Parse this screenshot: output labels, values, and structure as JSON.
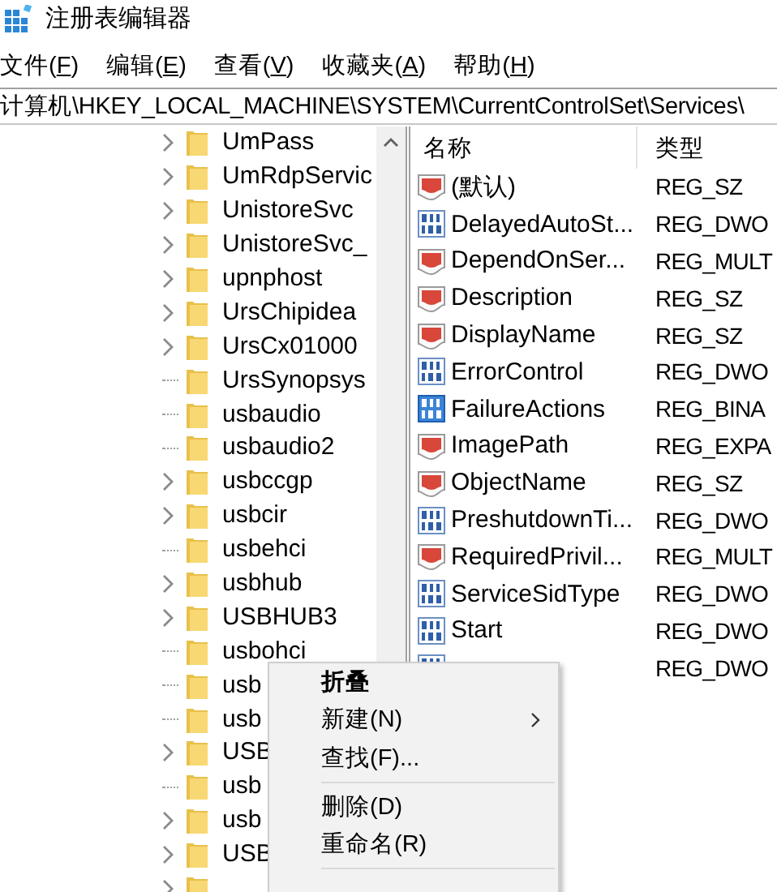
{
  "window": {
    "title": "注册表编辑器"
  },
  "menu_bar": [
    {
      "label": "文件(F)"
    },
    {
      "label": "编辑(E)"
    },
    {
      "label": "查看(V)"
    },
    {
      "label": "收藏夹(A)"
    },
    {
      "label": "帮助(H)"
    }
  ],
  "address_bar": {
    "value": "计算机\\HKEY_LOCAL_MACHINE\\SYSTEM\\CurrentControlSet\\Services\\"
  },
  "tree": {
    "items": [
      {
        "label": "UmPass",
        "expandable": true
      },
      {
        "label": "UmRdpServic",
        "expandable": true
      },
      {
        "label": "UnistoreSvc",
        "expandable": true
      },
      {
        "label": "UnistoreSvc_",
        "expandable": true
      },
      {
        "label": "upnphost",
        "expandable": true
      },
      {
        "label": "UrsChipidea",
        "expandable": true
      },
      {
        "label": "UrsCx01000",
        "expandable": true
      },
      {
        "label": "UrsSynopsys",
        "expandable": false
      },
      {
        "label": "usbaudio",
        "expandable": false
      },
      {
        "label": "usbaudio2",
        "expandable": false
      },
      {
        "label": "usbccgp",
        "expandable": true
      },
      {
        "label": "usbcir",
        "expandable": true
      },
      {
        "label": "usbehci",
        "expandable": false
      },
      {
        "label": "usbhub",
        "expandable": true
      },
      {
        "label": "USBHUB3",
        "expandable": true
      },
      {
        "label": "usbohci",
        "expandable": false
      },
      {
        "label": "usb",
        "expandable": false
      },
      {
        "label": "usb",
        "expandable": false
      },
      {
        "label": "USB",
        "expandable": true
      },
      {
        "label": "usb",
        "expandable": false
      },
      {
        "label": "usb",
        "expandable": true
      },
      {
        "label": "USB",
        "expandable": true
      },
      {
        "expandable": true
      }
    ]
  },
  "values": {
    "columns": [
      "名称",
      "类型"
    ],
    "rows": [
      {
        "kind": "string",
        "name": "(默认)",
        "type": "REG_SZ"
      },
      {
        "kind": "number",
        "name": "DelayedAutoSt...",
        "type": "REG_DWO"
      },
      {
        "kind": "string",
        "name": "DependOnSer...",
        "type": "REG_MULT"
      },
      {
        "kind": "string",
        "name": "Description",
        "type": "REG_SZ"
      },
      {
        "kind": "string",
        "name": "DisplayName",
        "type": "REG_SZ"
      },
      {
        "kind": "number",
        "name": "ErrorControl",
        "type": "REG_DWO"
      },
      {
        "kind": "binary",
        "name": "FailureActions",
        "type": "REG_BINA"
      },
      {
        "kind": "string",
        "name": "ImagePath",
        "type": "REG_EXPA"
      },
      {
        "kind": "string",
        "name": "ObjectName",
        "type": "REG_SZ"
      },
      {
        "kind": "number",
        "name": "PreshutdownTi...",
        "type": "REG_DWO"
      },
      {
        "kind": "string",
        "name": "RequiredPrivil...",
        "type": "REG_MULT"
      },
      {
        "kind": "number",
        "name": "ServiceSidType",
        "type": "REG_DWO"
      },
      {
        "kind": "number",
        "name": "Start",
        "type": "REG_DWO"
      },
      {
        "kind": "number",
        "type": "REG_DWO"
      }
    ]
  },
  "context_menu": [
    {
      "kind": "item",
      "label": "折叠",
      "default": true,
      "submenu": false
    },
    {
      "kind": "item",
      "label": "新建(N)",
      "default": false,
      "submenu": true
    },
    {
      "kind": "item",
      "label": "查找(F)...",
      "default": false,
      "submenu": false
    },
    {
      "kind": "separator"
    },
    {
      "kind": "item",
      "label": "删除(D)",
      "default": false,
      "submenu": false
    },
    {
      "kind": "item",
      "label": "重命名(R)",
      "default": false,
      "submenu": false
    },
    {
      "kind": "separator"
    }
  ]
}
